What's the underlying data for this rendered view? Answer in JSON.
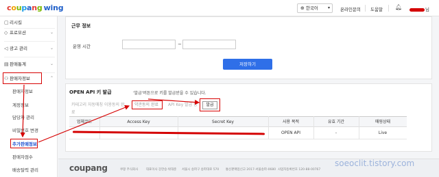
{
  "header": {
    "logo": [
      "c",
      "o",
      "u",
      "p",
      "a",
      "n",
      "g"
    ],
    "logo_suffix": "wing",
    "language": "한국어",
    "links": [
      "온라인문의",
      "도움말"
    ],
    "user_suffix": "님"
  },
  "sidebar": {
    "items": [
      {
        "label": "리시킬",
        "icon": "doc-icon"
      },
      {
        "label": "프로모션",
        "icon": "tag-icon"
      },
      {
        "label": "광고 관리",
        "icon": "megaphone-icon"
      },
      {
        "label": "판매통계",
        "icon": "chart-icon"
      },
      {
        "label": "판매자정보",
        "icon": "user-icon"
      }
    ],
    "sub_items": [
      "판매자정보",
      "계정정보",
      "담당자 관리",
      "비밀번호 변경",
      "추가판매정보",
      "판매자점수",
      "배송탈력 관리"
    ]
  },
  "work_info": {
    "title": "근무 정보",
    "hours_label": "운영 시간",
    "tilde": "~",
    "save_label": "저장하기"
  },
  "api": {
    "title": "OPEN API 키 발급",
    "note": "'발급'버튼으로 키를 발급받을 수 있습니다.",
    "inputs": [
      "카테고리 자동매칭 이용동의 완료",
      "약관동의 완료",
      "API Key 발급 중"
    ],
    "issue_label": "발급",
    "table": {
      "headers": [
        "업체코드",
        "Access Key",
        "Secret Key",
        "사용 목적",
        "유효 기간",
        "매핑상태"
      ],
      "row": [
        "",
        "",
        "",
        "OPEN API",
        "-",
        "Live"
      ]
    }
  },
  "footer": {
    "logo": "coupang",
    "items": [
      "쿠팡 주식회사",
      "대표이사 강한승·박대준",
      "서울시 송파구 송파대로 570",
      "통신판매업신고 2017-서울송파-0680",
      "사업자등록번호 120-88-00767"
    ]
  },
  "watermark": "soeoclit.tistory.com"
}
